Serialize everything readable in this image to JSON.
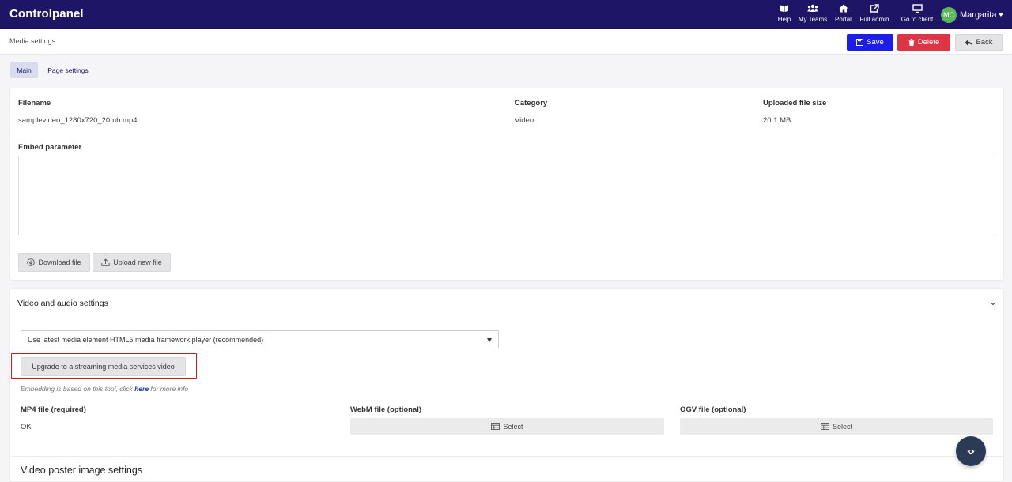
{
  "app": {
    "brand": "Controlpanel"
  },
  "nav": {
    "help": "Help",
    "teams": "My Teams",
    "portal": "Portal",
    "full_admin": "Full admin",
    "go_to_client": "Go to client"
  },
  "user": {
    "initials": "MC",
    "name": "Margarita",
    "avatar_color": "#5cb85c"
  },
  "header": {
    "breadcrumb": "Media settings",
    "save": "Save",
    "delete": "Delete",
    "back": "Back"
  },
  "tabs": [
    {
      "label": "Main",
      "active": true
    },
    {
      "label": "Page settings",
      "active": false
    }
  ],
  "file": {
    "filename_label": "Filename",
    "filename": "samplevideo_1280x720_20mb.mp4",
    "category_label": "Category",
    "category": "Video",
    "size_label": "Uploaded file size",
    "size": "20.1 MB",
    "embed_label": "Embed parameter",
    "embed_value": "",
    "download": "Download file",
    "upload": "Upload new file"
  },
  "video": {
    "section_title": "Video and audio settings",
    "player_option": "Use latest media element HTML5 media framework player (recommended)",
    "upgrade": "Upgrade to a streaming media services video",
    "note_prefix": "Embedding is based on this tool, click ",
    "note_link": "here",
    "note_suffix": " for more info",
    "mp4_label": "MP4 file (required)",
    "mp4_value": "OK",
    "webm_label": "WebM file (optional)",
    "webm_select": "Select",
    "ogv_label": "OGV file (optional)",
    "ogv_select": "Select"
  },
  "poster": {
    "title": "Video poster image settings"
  },
  "colors": {
    "nav_bg": "#1e1566",
    "save": "#1d1de8",
    "delete": "#dc3545",
    "highlight": "#d01818",
    "fab": "#2b3a55"
  },
  "icons": [
    "help-icon",
    "teams-icon",
    "home-icon",
    "external-link-icon",
    "monitor-icon",
    "save-icon",
    "trash-icon",
    "back-arrow-icon",
    "download-icon",
    "upload-icon",
    "chevron-down-icon",
    "table-icon",
    "eye-icon"
  ]
}
